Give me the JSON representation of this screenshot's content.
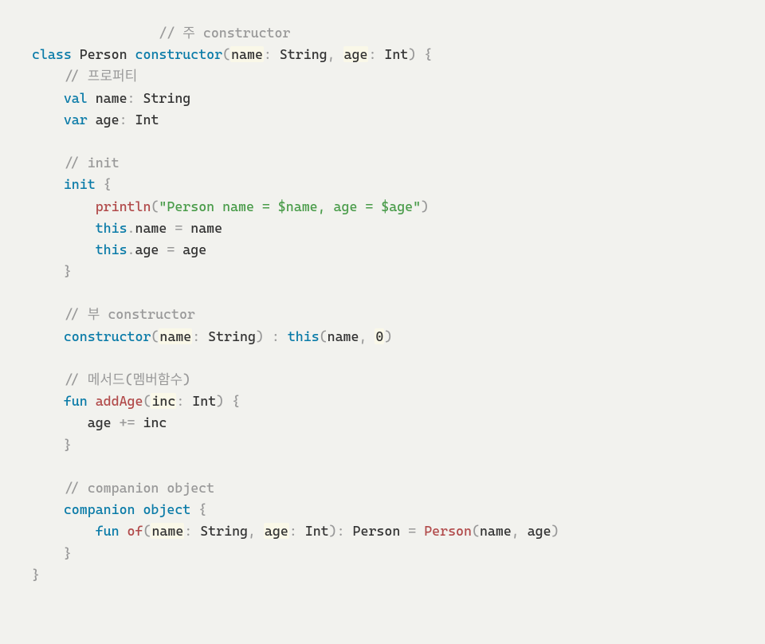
{
  "code": {
    "c1": "// 주 constructor",
    "kw_class": "class",
    "cls_name": "Person",
    "kw_constructor": "constructor",
    "p_name": "name",
    "t_string": "String",
    "p_age": "age",
    "t_int": "Int",
    "c2": "// 프로퍼티",
    "kw_val": "val",
    "kw_var": "var",
    "prop_name": "name",
    "prop_age": "age",
    "c3": "// init",
    "kw_init": "init",
    "fn_println": "println",
    "str_lit": "\"Person name = $name, age = $age\"",
    "kw_this": "this",
    "c4": "// 부 constructor",
    "num_zero": "0",
    "c5": "// 메서드(멤버함수)",
    "kw_fun": "fun",
    "fn_addAge": "addAge",
    "p_inc": "inc",
    "var_age": "age",
    "var_inc": "inc",
    "c6": "// companion object",
    "kw_companion": "companion",
    "kw_object": "object",
    "fn_of": "of",
    "fn_Person": "Person"
  }
}
